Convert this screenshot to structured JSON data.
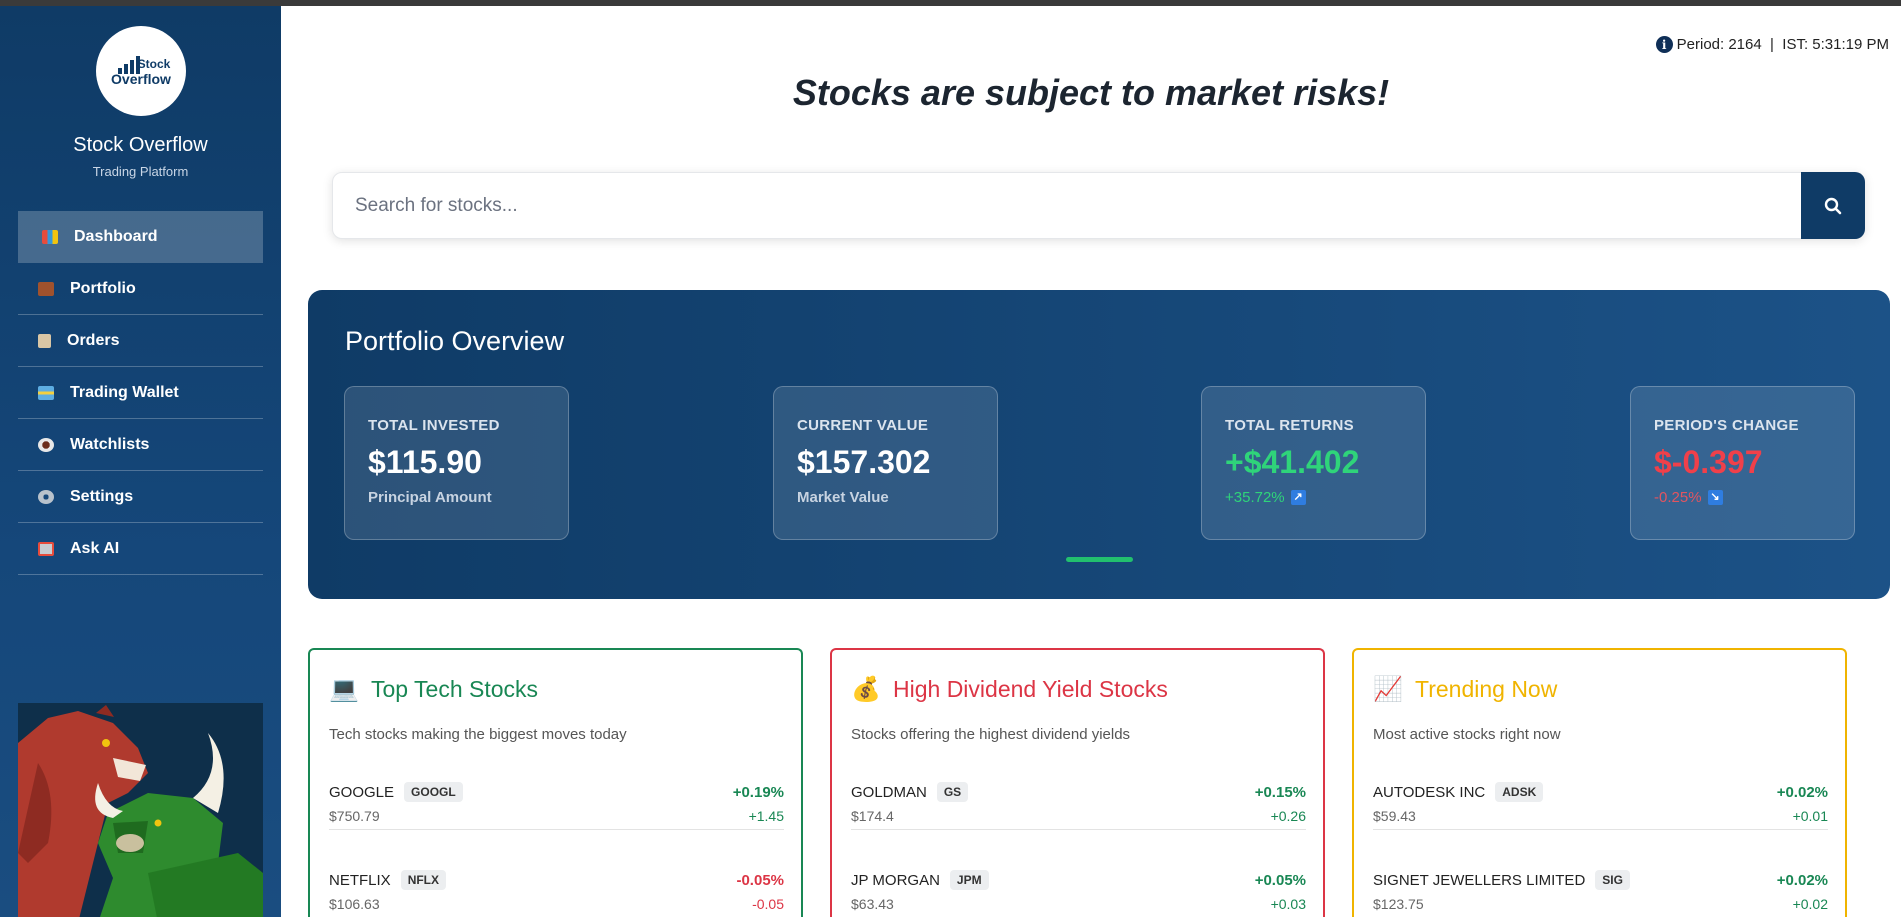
{
  "brand": {
    "logo_line1": "Stock",
    "logo_line2": "Overflow",
    "name": "Stock Overflow",
    "subtitle": "Trading Platform"
  },
  "sidebar": {
    "items": [
      {
        "label": "Dashboard",
        "icon": "chart-icon",
        "active": true
      },
      {
        "label": "Portfolio",
        "icon": "briefcase-icon"
      },
      {
        "label": "Orders",
        "icon": "clipboard-icon"
      },
      {
        "label": "Trading Wallet",
        "icon": "credit-card-icon"
      },
      {
        "label": "Watchlists",
        "icon": "eye-icon"
      },
      {
        "label": "Settings",
        "icon": "gear-icon"
      },
      {
        "label": "Ask AI",
        "icon": "robot-icon"
      }
    ]
  },
  "header": {
    "period_text": "Period: 2164  |  IST: 5:31:19 PM",
    "headline": "Stocks are subject to market risks!"
  },
  "search": {
    "placeholder": "Search for stocks...",
    "value": ""
  },
  "overview": {
    "title": "Portfolio Overview",
    "cards": [
      {
        "label": "TOTAL INVESTED",
        "value": "$115.90",
        "sub": "Principal Amount"
      },
      {
        "label": "CURRENT VALUE",
        "value": "$157.302",
        "sub": "Market Value"
      },
      {
        "label": "TOTAL RETURNS",
        "value": "+$41.402",
        "sub": "+35.72%",
        "arrow": "↗"
      },
      {
        "label": "PERIOD'S CHANGE",
        "value": "$-0.397",
        "sub": "-0.25%",
        "arrow": "↘"
      }
    ]
  },
  "panels": [
    {
      "title": "Top Tech Stocks",
      "emoji": "💻",
      "description": "Tech stocks making the biggest moves today",
      "color": "#198754",
      "stocks": [
        {
          "name": "GOOGLE",
          "ticker": "GOOGL",
          "price": "$750.79",
          "pct": "+0.19%",
          "change": "+1.45"
        },
        {
          "name": "NETFLIX",
          "ticker": "NFLX",
          "price": "$106.63",
          "pct": "-0.05%",
          "change": "-0.05"
        }
      ]
    },
    {
      "title": "High Dividend Yield Stocks",
      "emoji": "💰",
      "description": "Stocks offering the highest dividend yields",
      "color": "#dc3545",
      "stocks": [
        {
          "name": "GOLDMAN",
          "ticker": "GS",
          "price": "$174.4",
          "pct": "+0.15%",
          "change": "+0.26"
        },
        {
          "name": "JP MORGAN",
          "ticker": "JPM",
          "price": "$63.43",
          "pct": "+0.05%",
          "change": "+0.03"
        }
      ]
    },
    {
      "title": "Trending Now",
      "emoji": "📈",
      "description": "Most active stocks right now",
      "color": "#f0b400",
      "stocks": [
        {
          "name": "AUTODESK INC",
          "ticker": "ADSK",
          "price": "$59.43",
          "pct": "+0.02%",
          "change": "+0.01"
        },
        {
          "name": "SIGNET JEWELLERS LIMITED",
          "ticker": "SIG",
          "price": "$123.75",
          "pct": "+0.02%",
          "change": "+0.02"
        }
      ]
    }
  ],
  "colors": {
    "primary": "#0f3b66",
    "positive": "#198754",
    "negative": "#dc3545",
    "overview_positive": "#2fd47a",
    "overview_negative": "#f0404a"
  }
}
